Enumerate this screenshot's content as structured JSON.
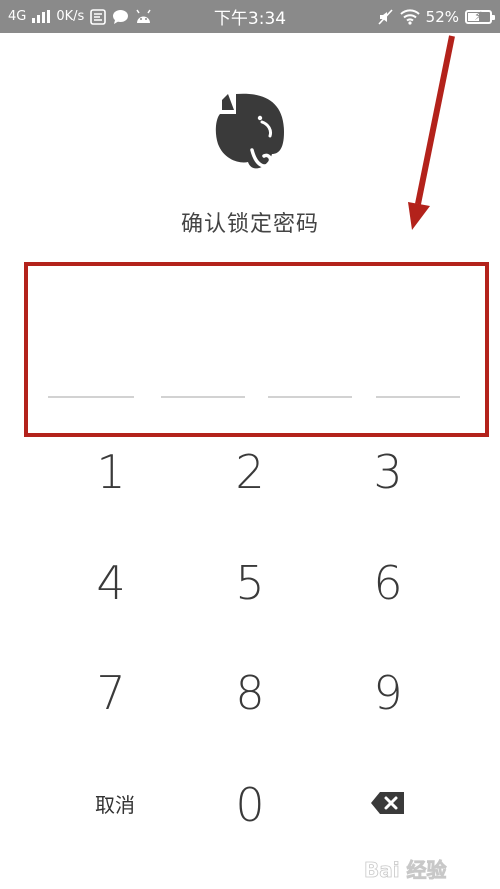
{
  "status_bar": {
    "network": "4G",
    "speed": "0K/s",
    "time": "下午3:34",
    "battery_percent": "52%",
    "battery_level": 0.52,
    "bg_color": "#8a8a8a"
  },
  "app": {
    "logo_icon": "evernote-elephant-icon",
    "title": "确认锁定密码",
    "pin_length": 4
  },
  "keypad": {
    "keys": [
      "1",
      "2",
      "3",
      "4",
      "5",
      "6",
      "7",
      "8",
      "9"
    ],
    "cancel_label": "取消",
    "zero": "0",
    "delete_icon": "backspace-icon"
  },
  "annotation": {
    "highlight_color": "#b3221b",
    "arrow_color": "#b3221b"
  },
  "watermark": {
    "text": "Bai 经验"
  }
}
